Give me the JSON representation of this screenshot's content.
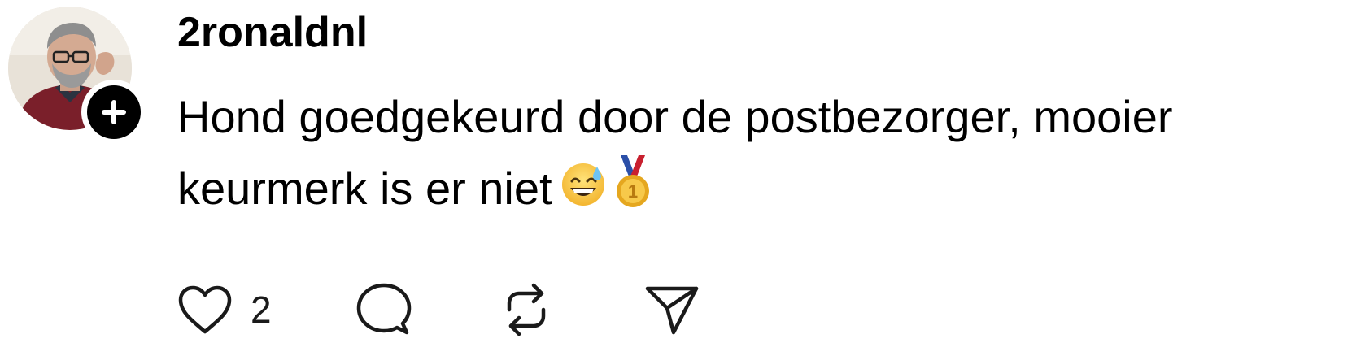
{
  "post": {
    "username": "2ronaldnl",
    "text": "Hond goedgekeurd door de postbezorger, mooier keurmerk is er niet",
    "emojis": [
      "grinning-face-with-sweat",
      "first-place-medal"
    ]
  },
  "actions": {
    "like_count": "2",
    "icons": [
      "heart-icon",
      "comment-icon",
      "repost-icon",
      "share-icon"
    ]
  },
  "colors": {
    "text": "#000000",
    "background": "#ffffff",
    "follow_badge": "#000000",
    "medal_ribbon_red": "#c8202f",
    "medal_ribbon_blue": "#2b4fa8",
    "medal_gold": "#e5a71f",
    "emoji_face": "#f7c23e"
  }
}
